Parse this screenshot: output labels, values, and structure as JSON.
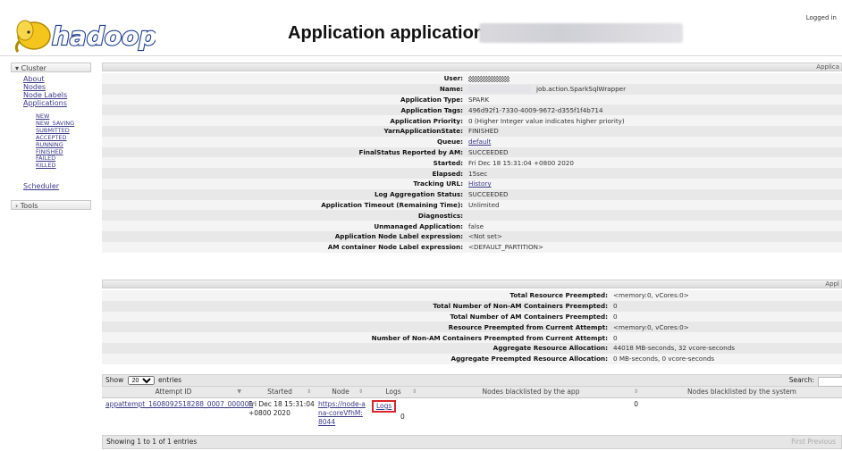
{
  "header": {
    "logo_text": "hadoop",
    "title": "Application application_",
    "logged_in": "Logged in"
  },
  "sidebar": {
    "cluster_label": "Cluster",
    "links": [
      "About",
      "Nodes",
      "Node Labels",
      "Applications"
    ],
    "app_states": [
      "NEW",
      "NEW_SAVING",
      "SUBMITTED",
      "ACCEPTED",
      "RUNNING",
      "FINISHED",
      "FAILED",
      "KILLED"
    ],
    "scheduler_label": "Scheduler",
    "tools_label": "Tools"
  },
  "overview": {
    "panel_title": "Applica",
    "rows": [
      {
        "label": "User:",
        "value": ""
      },
      {
        "label": "Name:",
        "value": "job.action.SparkSqlWrapper"
      },
      {
        "label": "Application Type:",
        "value": "SPARK"
      },
      {
        "label": "Application Tags:",
        "value": "496d92f1-7330-4009-9672-d355f1f4b714"
      },
      {
        "label": "Application Priority:",
        "value": "0 (Higher Integer value indicates higher priority)"
      },
      {
        "label": "YarnApplicationState:",
        "value": "FINISHED"
      },
      {
        "label": "Queue:",
        "value": "default"
      },
      {
        "label": "FinalStatus Reported by AM:",
        "value": "SUCCEEDED"
      },
      {
        "label": "Started:",
        "value": "Fri Dec 18 15:31:04 +0800 2020"
      },
      {
        "label": "Elapsed:",
        "value": "15sec"
      },
      {
        "label": "Tracking URL:",
        "value": "History"
      },
      {
        "label": "Log Aggregation Status:",
        "value": "SUCCEEDED"
      },
      {
        "label": "Application Timeout (Remaining Time):",
        "value": "Unlimited"
      },
      {
        "label": "Diagnostics:",
        "value": ""
      },
      {
        "label": "Unmanaged Application:",
        "value": "false"
      },
      {
        "label": "Application Node Label expression:",
        "value": "<Not set>"
      },
      {
        "label": "AM container Node Label expression:",
        "value": "<DEFAULT_PARTITION>"
      }
    ]
  },
  "metrics": {
    "panel_title": "Appl",
    "rows": [
      {
        "label": "Total Resource Preempted:",
        "value": "<memory:0, vCores:0>"
      },
      {
        "label": "Total Number of Non-AM Containers Preempted:",
        "value": "0"
      },
      {
        "label": "Total Number of AM Containers Preempted:",
        "value": "0"
      },
      {
        "label": "Resource Preempted from Current Attempt:",
        "value": "<memory:0, vCores:0>"
      },
      {
        "label": "Number of Non-AM Containers Preempted from Current Attempt:",
        "value": "0"
      },
      {
        "label": "Aggregate Resource Allocation:",
        "value": "44018 MB-seconds, 32 vcore-seconds"
      },
      {
        "label": "Aggregate Preempted Resource Allocation:",
        "value": "0 MB-seconds, 0 vcore-seconds"
      }
    ]
  },
  "attempts": {
    "show_label": "Show",
    "page_size": "20",
    "entries_label": "entries",
    "search_label": "Search:",
    "columns": [
      "Attempt ID",
      "Started",
      "Node",
      "Logs",
      "Nodes blacklisted by the app",
      "Nodes blacklisted by the system"
    ],
    "row": {
      "attempt_id": "appattempt_1608092518288_0007_000001",
      "started": "Fri Dec 18 15:31:04 +0800 2020",
      "node": "https://node-ana-coreVfhM:8044",
      "logs": "Logs",
      "blacklisted_app": "0",
      "blacklisted_system": "0"
    },
    "footer": "Showing 1 to 1 of 1 entries",
    "pager": "First  Previous"
  }
}
